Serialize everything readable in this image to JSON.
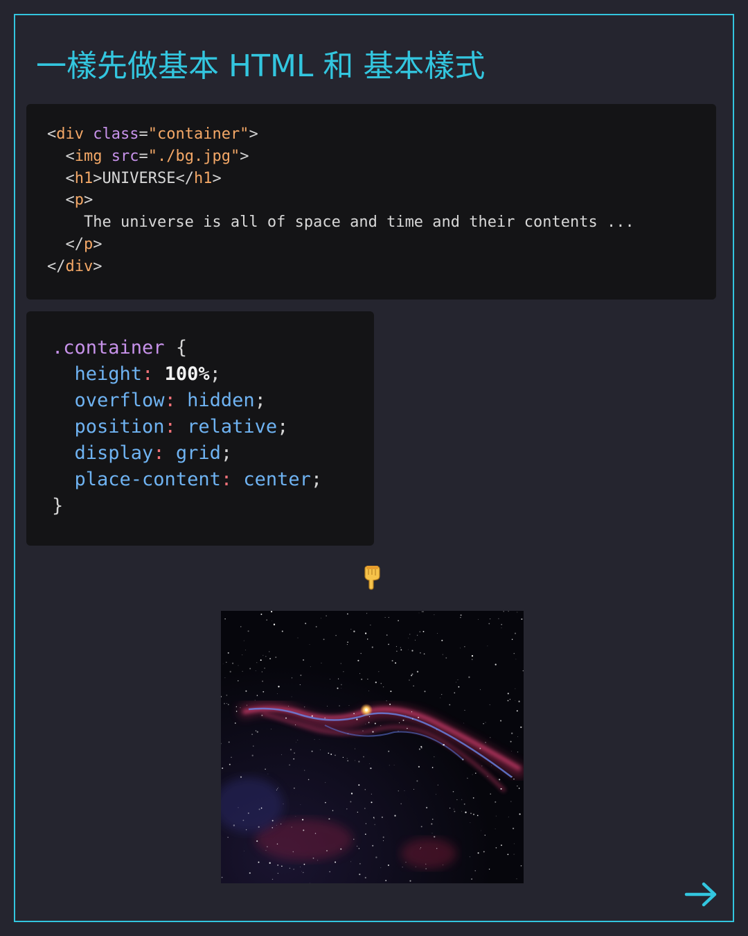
{
  "title": "一樣先做基本 HTML 和 基本樣式",
  "html_code": {
    "line1": {
      "open": "<",
      "tag": "div",
      "attr": " class",
      "eq": "=",
      "value": "\"container\"",
      "close": ">"
    },
    "line2": {
      "indent": "  ",
      "open": "<",
      "tag": "img",
      "attr": " src",
      "eq": "=",
      "value": "\"./bg.jpg\"",
      "close": ">"
    },
    "line3": {
      "indent": "  ",
      "open": "<",
      "tag": "h1",
      "close": ">",
      "text": "UNIVERSE",
      "end_open": "</",
      "end_tag": "h1",
      "end_close": ">"
    },
    "line4": {
      "indent": "  ",
      "open": "<",
      "tag": "p",
      "close": ">"
    },
    "line5": {
      "indent": "    ",
      "text": "The universe is all of space and time and their contents ..."
    },
    "line6": {
      "indent": "  ",
      "open": "</",
      "tag": "p",
      "close": ">"
    },
    "line7": {
      "open": "</",
      "tag": "div",
      "close": ">"
    }
  },
  "css_code": {
    "selector": ".container",
    "open_brace": " {",
    "close_brace": "}",
    "declarations": [
      {
        "property": "height",
        "value": "100%"
      },
      {
        "property": "overflow",
        "value": "hidden"
      },
      {
        "property": "position",
        "value": "relative"
      },
      {
        "property": "display",
        "value": "grid"
      },
      {
        "property": "place-content",
        "value": "center"
      }
    ]
  },
  "pointer": {
    "icon": "pointing-down-hand-icon"
  },
  "preview_image": {
    "subject": "nebula-starfield",
    "icon": "space-photo"
  },
  "navigation": {
    "icon": "arrow-right-icon",
    "color": "#33c6df"
  },
  "colors": {
    "background": "#25252f",
    "accent": "#33c6df",
    "code_background": "#141416",
    "tag": "#f4a867",
    "attribute": "#c792ea",
    "property": "#6fb3f2",
    "colon": "#f07178"
  }
}
